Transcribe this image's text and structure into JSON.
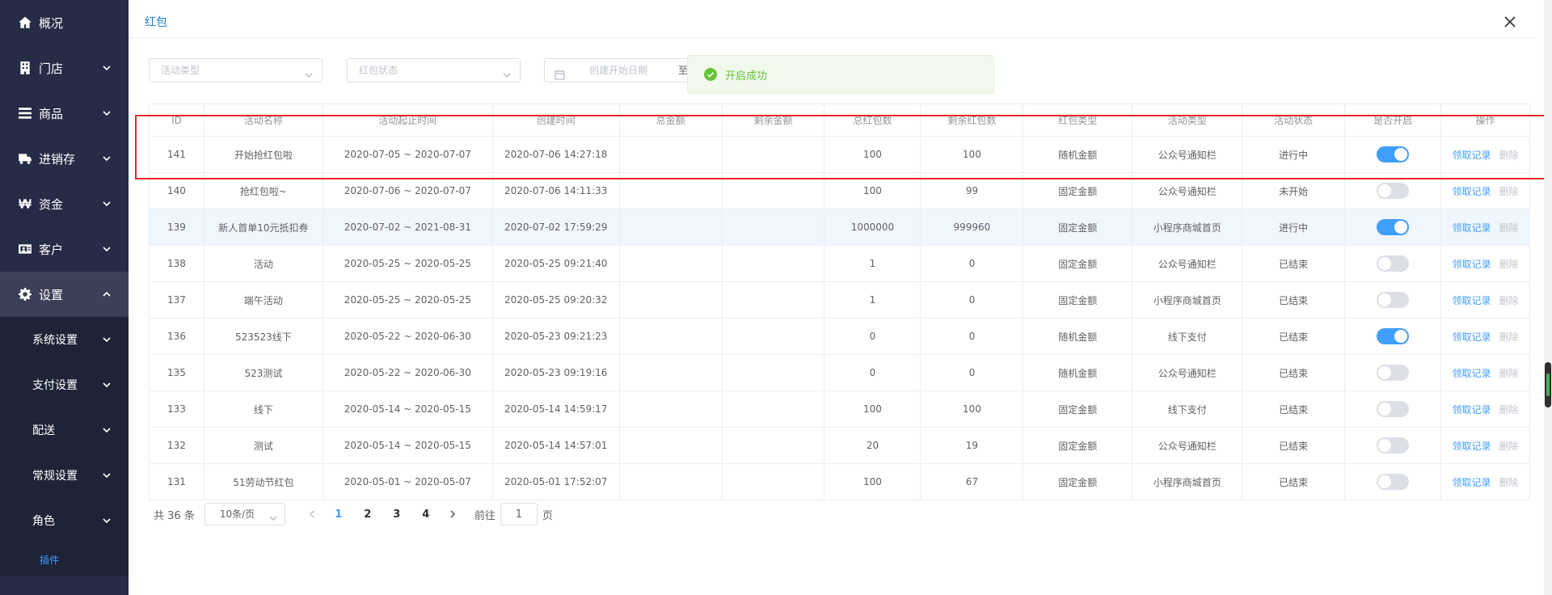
{
  "sidebar": {
    "items": [
      {
        "label": "概况",
        "icon": "home-icon",
        "has_chevron": false
      },
      {
        "label": "门店",
        "icon": "building-icon",
        "has_chevron": true
      },
      {
        "label": "商品",
        "icon": "list-icon",
        "has_chevron": true
      },
      {
        "label": "进销存",
        "icon": "truck-icon",
        "has_chevron": true
      },
      {
        "label": "资金",
        "icon": "won-icon",
        "has_chevron": true
      },
      {
        "label": "客户",
        "icon": "id-card-icon",
        "has_chevron": true
      },
      {
        "label": "设置",
        "icon": "gear-icon",
        "has_chevron": true,
        "expanded": true
      }
    ],
    "settings_sub": [
      {
        "label": "系统设置"
      },
      {
        "label": "支付设置"
      },
      {
        "label": "配送"
      },
      {
        "label": "常规设置"
      },
      {
        "label": "角色"
      }
    ],
    "leaf": {
      "label": "插件"
    }
  },
  "dialog": {
    "title": "红包"
  },
  "filters": {
    "activity_type_placeholder": "活动类型",
    "status_placeholder": "红包状态",
    "date_start_placeholder": "创建开始日期",
    "date_sep": "至"
  },
  "toast": {
    "message": "开启成功"
  },
  "table": {
    "headers": [
      "ID",
      "活动名称",
      "活动起止时间",
      "创建时间",
      "总金额",
      "剩余金额",
      "总红包数",
      "剩余红包数",
      "红包类型",
      "活动类型",
      "活动状态",
      "是否开启",
      "操作"
    ],
    "rows": [
      {
        "id": "141",
        "name": "开始抢红包啦",
        "period": "2020-07-05 ~ 2020-07-07",
        "created": "2020-07-06 14:27:18",
        "total_amount": "",
        "remaining_amount": "",
        "total_count": "100",
        "remaining_count": "100",
        "rp_type": "随机金额",
        "act_type": "公众号通知栏",
        "status": "进行中",
        "enabled": true
      },
      {
        "id": "140",
        "name": "抢红包啦~",
        "period": "2020-07-06 ~ 2020-07-07",
        "created": "2020-07-06 14:11:33",
        "total_amount": "",
        "remaining_amount": "",
        "total_count": "100",
        "remaining_count": "99",
        "rp_type": "固定金额",
        "act_type": "公众号通知栏",
        "status": "未开始",
        "enabled": false
      },
      {
        "id": "139",
        "name": "新人首单10元抵扣券",
        "period": "2020-07-02 ~ 2021-08-31",
        "created": "2020-07-02 17:59:29",
        "total_amount": "",
        "remaining_amount": "",
        "total_count": "1000000",
        "remaining_count": "999960",
        "rp_type": "固定金额",
        "act_type": "小程序商城首页",
        "status": "进行中",
        "enabled": true
      },
      {
        "id": "138",
        "name": "活动",
        "period": "2020-05-25 ~ 2020-05-25",
        "created": "2020-05-25 09:21:40",
        "total_amount": "",
        "remaining_amount": "",
        "total_count": "1",
        "remaining_count": "0",
        "rp_type": "固定金额",
        "act_type": "公众号通知栏",
        "status": "已结束",
        "enabled": false
      },
      {
        "id": "137",
        "name": "端午活动",
        "period": "2020-05-25 ~ 2020-05-25",
        "created": "2020-05-25 09:20:32",
        "total_amount": "",
        "remaining_amount": "",
        "total_count": "1",
        "remaining_count": "0",
        "rp_type": "固定金额",
        "act_type": "小程序商城首页",
        "status": "已结束",
        "enabled": false
      },
      {
        "id": "136",
        "name": "523523线下",
        "period": "2020-05-22 ~ 2020-06-30",
        "created": "2020-05-23 09:21:23",
        "total_amount": "",
        "remaining_amount": "",
        "total_count": "0",
        "remaining_count": "0",
        "rp_type": "随机金额",
        "act_type": "线下支付",
        "status": "已结束",
        "enabled": true
      },
      {
        "id": "135",
        "name": "523测试",
        "period": "2020-05-22 ~ 2020-06-30",
        "created": "2020-05-23 09:19:16",
        "total_amount": "",
        "remaining_amount": "",
        "total_count": "0",
        "remaining_count": "0",
        "rp_type": "随机金额",
        "act_type": "公众号通知栏",
        "status": "已结束",
        "enabled": false
      },
      {
        "id": "133",
        "name": "线下",
        "period": "2020-05-14 ~ 2020-05-15",
        "created": "2020-05-14 14:59:17",
        "total_amount": "",
        "remaining_amount": "",
        "total_count": "100",
        "remaining_count": "100",
        "rp_type": "固定金额",
        "act_type": "线下支付",
        "status": "已结束",
        "enabled": false
      },
      {
        "id": "132",
        "name": "测试",
        "period": "2020-05-14 ~ 2020-05-15",
        "created": "2020-05-14 14:57:01",
        "total_amount": "",
        "remaining_amount": "",
        "total_count": "20",
        "remaining_count": "19",
        "rp_type": "固定金额",
        "act_type": "公众号通知栏",
        "status": "已结束",
        "enabled": false
      },
      {
        "id": "131",
        "name": "51劳动节红包",
        "period": "2020-05-01 ~ 2020-05-07",
        "created": "2020-05-01 17:52:07",
        "total_amount": "",
        "remaining_amount": "",
        "total_count": "100",
        "remaining_count": "67",
        "rp_type": "固定金额",
        "act_type": "小程序商城首页",
        "status": "已结束",
        "enabled": false
      }
    ],
    "action_link": "领取记录",
    "action_delete": "删除"
  },
  "pagination": {
    "total": "共 36 条",
    "page_size": "10条/页",
    "pages": [
      "1",
      "2",
      "3",
      "4"
    ],
    "current": "1",
    "goto_label": "前往",
    "goto_value": "1",
    "goto_suffix": "页"
  },
  "colors": {
    "sidebar_bg": "#262b46",
    "accent": "#409eff",
    "success": "#67c23a",
    "highlight": "#e8262c"
  }
}
